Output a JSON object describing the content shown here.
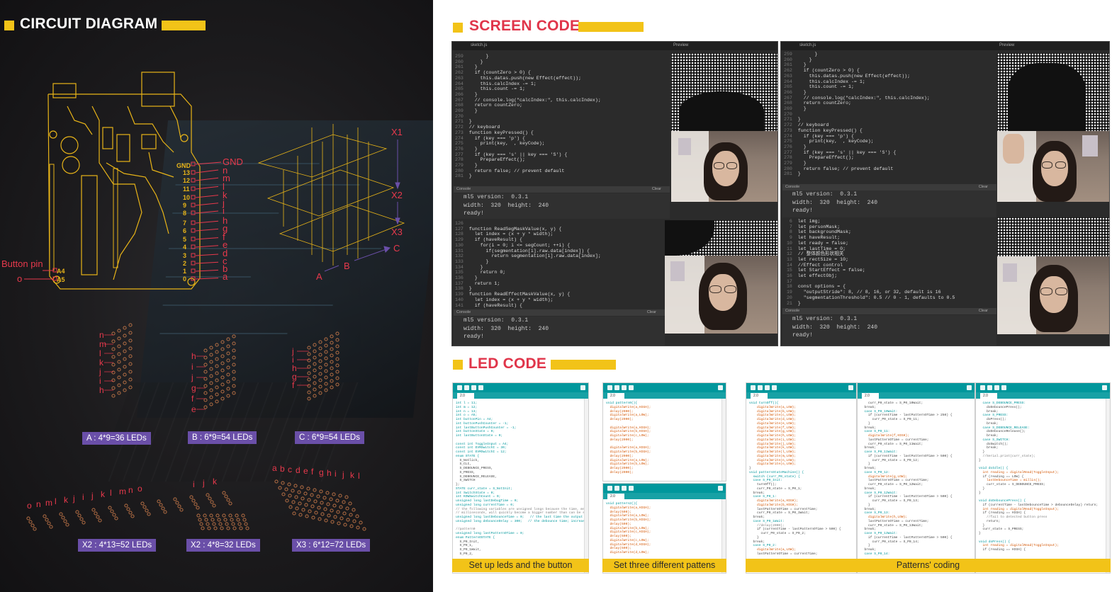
{
  "sections": {
    "circuit": "CIRCUIT DIAGRAM",
    "screen": "SCREEN CODE",
    "led": "LED CODE"
  },
  "circuit": {
    "pin_numbers": [
      "13",
      "12",
      "11",
      "10",
      "9",
      "8",
      "7",
      "6",
      "5",
      "4",
      "3",
      "2",
      "1",
      "0"
    ],
    "pin_letters": [
      "n",
      "m",
      "l",
      "k",
      "j",
      "i",
      "h",
      "g",
      "f",
      "e",
      "d",
      "c",
      "b",
      "a"
    ],
    "gnd_pin": "GND",
    "gnd_label": "GND",
    "button_label": "Button pin",
    "a4": "A4",
    "a5": "A5",
    "button_letter": "o",
    "axis": {
      "x1": "X1",
      "x2": "X2",
      "x3": "X3",
      "a": "A",
      "b": "B",
      "c": "C"
    },
    "layouts": [
      {
        "caption": "A : 4*9=36 LEDs",
        "letters": [
          "n",
          "m",
          "l",
          "k",
          "j",
          "i",
          "h"
        ]
      },
      {
        "caption": "B : 6*9=54 LEDs",
        "letters": [
          "h",
          "i",
          "j",
          "g",
          "f",
          "e"
        ]
      },
      {
        "caption": "C : 6*9=54 LEDs",
        "letters": [
          "j",
          "i",
          "h",
          "g",
          "f"
        ]
      },
      {
        "caption": "X2 : 4*13=52 LEDs",
        "letters": [
          "o",
          "n",
          "m",
          "l",
          "k",
          "j",
          "i",
          "j",
          "k",
          "l",
          "m",
          "n",
          "o"
        ]
      },
      {
        "caption": "X2 : 4*8=32 LEDs",
        "letters": [
          "i",
          "j",
          "k"
        ]
      },
      {
        "caption": "X3 : 6*12=72 LEDs",
        "letters": [
          "a",
          "b",
          "c",
          "d",
          "e",
          "f",
          "g",
          "h",
          "i",
          "j",
          "k",
          "l"
        ]
      }
    ]
  },
  "screen_code": {
    "file_tab": "sketch.js",
    "preview_tab": "Preview",
    "console_tab": "Console",
    "clear_btn": "Clear",
    "console_lines": [
      "ml5 version:  0.3.1",
      "width:  320  height:  240",
      "ready!"
    ],
    "snippet_top_left": [
      [
        "259",
        "      }"
      ],
      [
        "260",
        "    }"
      ],
      [
        "261",
        "  }"
      ],
      [
        "262",
        "  if (countZero > 0) {"
      ],
      [
        "263",
        "    this.datas.push(new Effect(effect));"
      ],
      [
        "264",
        "    this.calcIndex -= 1;"
      ],
      [
        "265",
        "    this.count -= 1;"
      ],
      [
        "266",
        "  }"
      ],
      [
        "267",
        "  // console.log(\"calcIndex:\", this.calcIndex);"
      ],
      [
        "268",
        "  return countZero;"
      ],
      [
        "269",
        "  }"
      ],
      [
        "270",
        ""
      ],
      [
        "271",
        "}"
      ],
      [
        "272",
        "// keyboard"
      ],
      [
        "273",
        "function keyPressed() {"
      ],
      [
        "274",
        "  if (key === 'p') {"
      ],
      [
        "275",
        "    print(key,  , keyCode);"
      ],
      [
        "276",
        "  }"
      ],
      [
        "277",
        "  if (key === 's' || key === 'S') {"
      ],
      [
        "278",
        "    PrepareEffect();"
      ],
      [
        "279",
        "  }"
      ],
      [
        "280",
        "  return false; // prevent default"
      ],
      [
        "281",
        "}"
      ]
    ],
    "snippet_bottom_left": [
      [
        "126",
        ""
      ],
      [
        "127",
        "function ReadSegMaskValue(x, y) {"
      ],
      [
        "128",
        "  let index = (x + y * width);"
      ],
      [
        "129",
        "  if (haveResult) {"
      ],
      [
        "130",
        "    for(i = 0; i <= segCount; ++i) {"
      ],
      [
        "131",
        "      if(segmentation[i].raw.data[index]) {"
      ],
      [
        "132",
        "        return segmentation[i].raw.data[index];"
      ],
      [
        "133",
        "      }"
      ],
      [
        "134",
        "    }"
      ],
      [
        "135",
        "    return 0;"
      ],
      [
        "136",
        "  }"
      ],
      [
        "137",
        "  return 1;"
      ],
      [
        "138",
        "}"
      ],
      [
        "139",
        "function ReadEffectMaskValue(x, y) {"
      ],
      [
        "140",
        "  let index = (x + y * width);"
      ],
      [
        "141",
        "  if (haveResult) {"
      ]
    ],
    "snippet_top_right": [
      [
        "259",
        "      }"
      ],
      [
        "260",
        "    }"
      ],
      [
        "261",
        "  }"
      ],
      [
        "262",
        "  if (countZero > 0) {"
      ],
      [
        "263",
        "    this.datas.push(new Effect(effect));"
      ],
      [
        "264",
        "    this.calcIndex -= 1;"
      ],
      [
        "265",
        "    this.count -= 1;"
      ],
      [
        "266",
        "  }"
      ],
      [
        "267",
        "  // console.log(\"calcIndex:\", this.calcIndex);"
      ],
      [
        "268",
        "  return countZero;"
      ],
      [
        "269",
        "  }"
      ],
      [
        "270",
        ""
      ],
      [
        "271",
        "}"
      ],
      [
        "272",
        "// keyboard"
      ],
      [
        "273",
        "function keyPressed() {"
      ],
      [
        "274",
        "  if (key === 'p') {"
      ],
      [
        "275",
        "    print(key,  , keyCode);"
      ],
      [
        "276",
        "  }"
      ],
      [
        "277",
        "  if (key === 's' || key === 'S') {"
      ],
      [
        "278",
        "    PrepareEffect();"
      ],
      [
        "279",
        "  }"
      ],
      [
        "280",
        "  return false; // prevent default"
      ],
      [
        "281",
        "}"
      ]
    ],
    "snippet_bottom_right": [
      [
        "6",
        "let img;"
      ],
      [
        "7",
        "let personMask;"
      ],
      [
        "8",
        "let backgroundMask;"
      ],
      [
        "9",
        "let haveResult;"
      ],
      [
        "10",
        "let ready = false;"
      ],
      [
        "11",
        "let lastTime = 0;"
      ],
      [
        "12",
        "// 整体颜色形状相关"
      ],
      [
        "13",
        "let rectSize = 10;"
      ],
      [
        "14",
        "//Effect control"
      ],
      [
        "15",
        "let StartEffect = false;"
      ],
      [
        "16",
        "let effectObj;"
      ],
      [
        "17",
        ""
      ],
      [
        "18",
        "const options = {"
      ],
      [
        "19",
        "  \"outputStride\": 8, // 8, 16, or 32, default is 16"
      ],
      [
        "20",
        "  \"segmentationThreshold\": 0.5 // 0 - 1, defaults to 0.5"
      ],
      [
        "21",
        "}"
      ]
    ]
  },
  "led_code": {
    "tab_name": "2.0",
    "captions": [
      "Set up leds and the button",
      "Set three different pattens",
      "Patterns' coding"
    ],
    "win1": [
      "int l = 11;",
      "int m = 12;",
      "int n = 13;",
      "int o = A5;",
      "int buttonPin = A4;",
      "int buttonPushCounter = -1;",
      "int lastButtonPushCounter = -1;",
      "int buttonState = 0;",
      "int lastButtonState = 0;",
      "",
      "const int ToggleInput = A4;",
      "const int EVMSwitchI = 30;",
      "const int EVMSwitchI = 12;",
      "enum STATE {",
      "  S_NoClick,",
      "  S_CLI,",
      "  S_DEBOUNCE_PRESS,",
      "  S_PRESS,",
      "  S_DEBOUNCE_RELEASE,",
      "  S_SWITCH",
      "};",
      "STATE curr_state = S_NotInit;",
      "int SwitchState = 0;",
      "int KOWSwitchCount = 0;",
      "unsigned long lastDebugTime = 0;",
      "unsigned long currentTime = 0;",
      "// the following variables are unsigned longs because the time, measured in",
      "// milliseconds, will quickly become a bigger number than can be stored in an",
      "unsigned long lastDebounceTime = 0;   // the last time the output pin was togg",
      "unsigned long debounceDelay = 300;   // the debounce time; increase if the o",
      "",
      "//pattern0",
      "unsigned long lastPatternOTime = 0;",
      "enum PatternOSTATE {",
      "  S_P0_Init,",
      "  S_P0_1,",
      "  S_P0_1Wait,",
      "  S_P0_2,"
    ],
    "win2": [
      "void pattern0(){",
      "  digitalWrite(a,HIGH);",
      "  delay(2000);",
      "  digitalWrite(a,LOW);",
      "  delay(2000);",
      "",
      "  digitalWrite(a,HIGH);",
      "  digitalWrite(b,HIGH);",
      "  digitalWrite(c,LOW);",
      "  delay(2000);",
      "",
      "  digitalWrite(a,HIGH);",
      "  digitalWrite(b,HIGH);",
      "  delay(2000);",
      "  digitalWrite(a,LOW);",
      "  digitalWrite(b,LOW);",
      "  delay(2000);",
      "  delay(2000);"
    ],
    "win3": [
      "void pattern2(){",
      "  digitalWrite(a,HIGH);",
      "  delay(500);",
      "  digitalWrite(a,LOW);",
      "  digitalWrite(b,HIGH);",
      "  delay(500);",
      "  digitalWrite(b,LOW);",
      "  digitalWrite(c,HIGH);",
      "  delay(500);",
      "  digitalWrite(c,LOW);",
      "  digitalWrite(d,HIGH);",
      "  delay(500);",
      "  digitalWrite(d,LOW);"
    ],
    "win4": [
      "void turnOff(){",
      "    digitalWrite(a,LOW);",
      "    digitalWrite(b,LOW);",
      "    digitalWrite(c,LOW);",
      "    digitalWrite(d,LOW);",
      "    digitalWrite(e,LOW);",
      "    digitalWrite(f,LOW);",
      "    digitalWrite(g,LOW);",
      "    digitalWrite(h,LOW);",
      "    digitalWrite(i,LOW);",
      "    digitalWrite(j,LOW);",
      "    digitalWrite(k,LOW);",
      "    digitalWrite(l,LOW);",
      "    digitalWrite(m,LOW);",
      "    digitalWrite(n,LOW);",
      "    digitalWrite(o,LOW);",
      "}",
      "void patternStateMachine() {",
      "  switch (curr_P0_state) {",
      "  case S_P0_Init:",
      "    turnOff();",
      "    curr_P0_state = S_P0_1;",
      "  break;",
      "  case S_P0_1:",
      "    digitalWrite(a,HIGH);",
      "    digitalWrite(b,HIGH);",
      "    lastPatternOTime = currentTime;",
      "    curr_P0_state = S_P0_1Wait;",
      "  break;",
      "  case S_P0_1Wait:",
      "    //delay(2000);",
      "    if (currentTime - lastPatternOTime > 500) {",
      "      curr_P0_state = S_P0_2;",
      "    }",
      "  break;",
      "  case S_P0_2:",
      "    digitalWrite(a,LOW);",
      "    lastPatternOTime = currentTime;"
    ],
    "win5": [
      "    curr_P0_state = S_P0_10Wait;",
      "  break;",
      "  case S_P0_10Wait:",
      "    if (currentTime - lastPatternOTime > 250) {",
      "      curr_P0_state = S_P0_11;",
      "    }",
      "  break;",
      "  case S_P0_11:",
      "    digitalWrite(f,HIGH);",
      "    lastPatternOTime = currentTime;",
      "    curr_P0_state = S_P0_11Wait;",
      "  break;",
      "  case S_P0_11Wait:",
      "    if (currentTime - lastPatternOTime > 500) {",
      "      curr_P0_state = S_P0_12;",
      "    }",
      "  break;",
      "  case S_P0_12:",
      "    digitalWrite(g,LOW);",
      "    lastPatternOTime = currentTime;",
      "    curr_P0_state = S_P0_12Wait;",
      "  break;",
      "  case S_P0_12Wait:",
      "    if (currentTime - lastPatternOTime > 500) {",
      "      curr_P0_state = S_P0_13;",
      "    }",
      "  break;",
      "  case S_P0_13:",
      "    digitalWrite(h,LOW);",
      "    lastPatternOTime = currentTime;",
      "    curr_P0_state = S_P0_13Wait;",
      "  break;",
      "  case S_P0_13Wait:",
      "    if (currentTime - lastPatternOTime > 500) {",
      "      curr_P0_state = S_P0_14;",
      "    }",
      "  break;",
      "  case S_P0_14:"
    ],
    "win6": [
      "  case S_DEBOUNCE_PRESS:",
      "    doDebouncePress();",
      "    break;",
      "  case S_PRESS:",
      "    doPress();",
      "    break;",
      "  case S_DEBOUNCE_RELEASE:",
      "    doDebounceRelease();",
      "    break;",
      "  case S_SWITCH:",
      "    doSwitch();",
      "    break;",
      "  }",
      "  //Serial.print(curr_state);",
      "}",
      "",
      "void doIdle() {",
      "  int reading = digitalRead(ToggleInput);",
      "  if (reading == LOW) {",
      "    lastDebounceTime = millis();",
      "    curr_state = S_DEBOUNCE_PRESS;",
      "  }",
      "}",
      "",
      "void doDebouncePress() {",
      "  if (currentTime - lastDebounceTime > debounceDelay) return;",
      "  int reading = digitalRead(ToggleInput);",
      "  if (reading == HIGH) {",
      "    //fail to detected button press",
      "    return;",
      "  }",
      "  curr_state = S_PRESS;",
      "}",
      "",
      "void doPress() {",
      "  int reading = digitalRead(ToggleInput);",
      "  if (reading == HIGH) {"
    ]
  }
}
